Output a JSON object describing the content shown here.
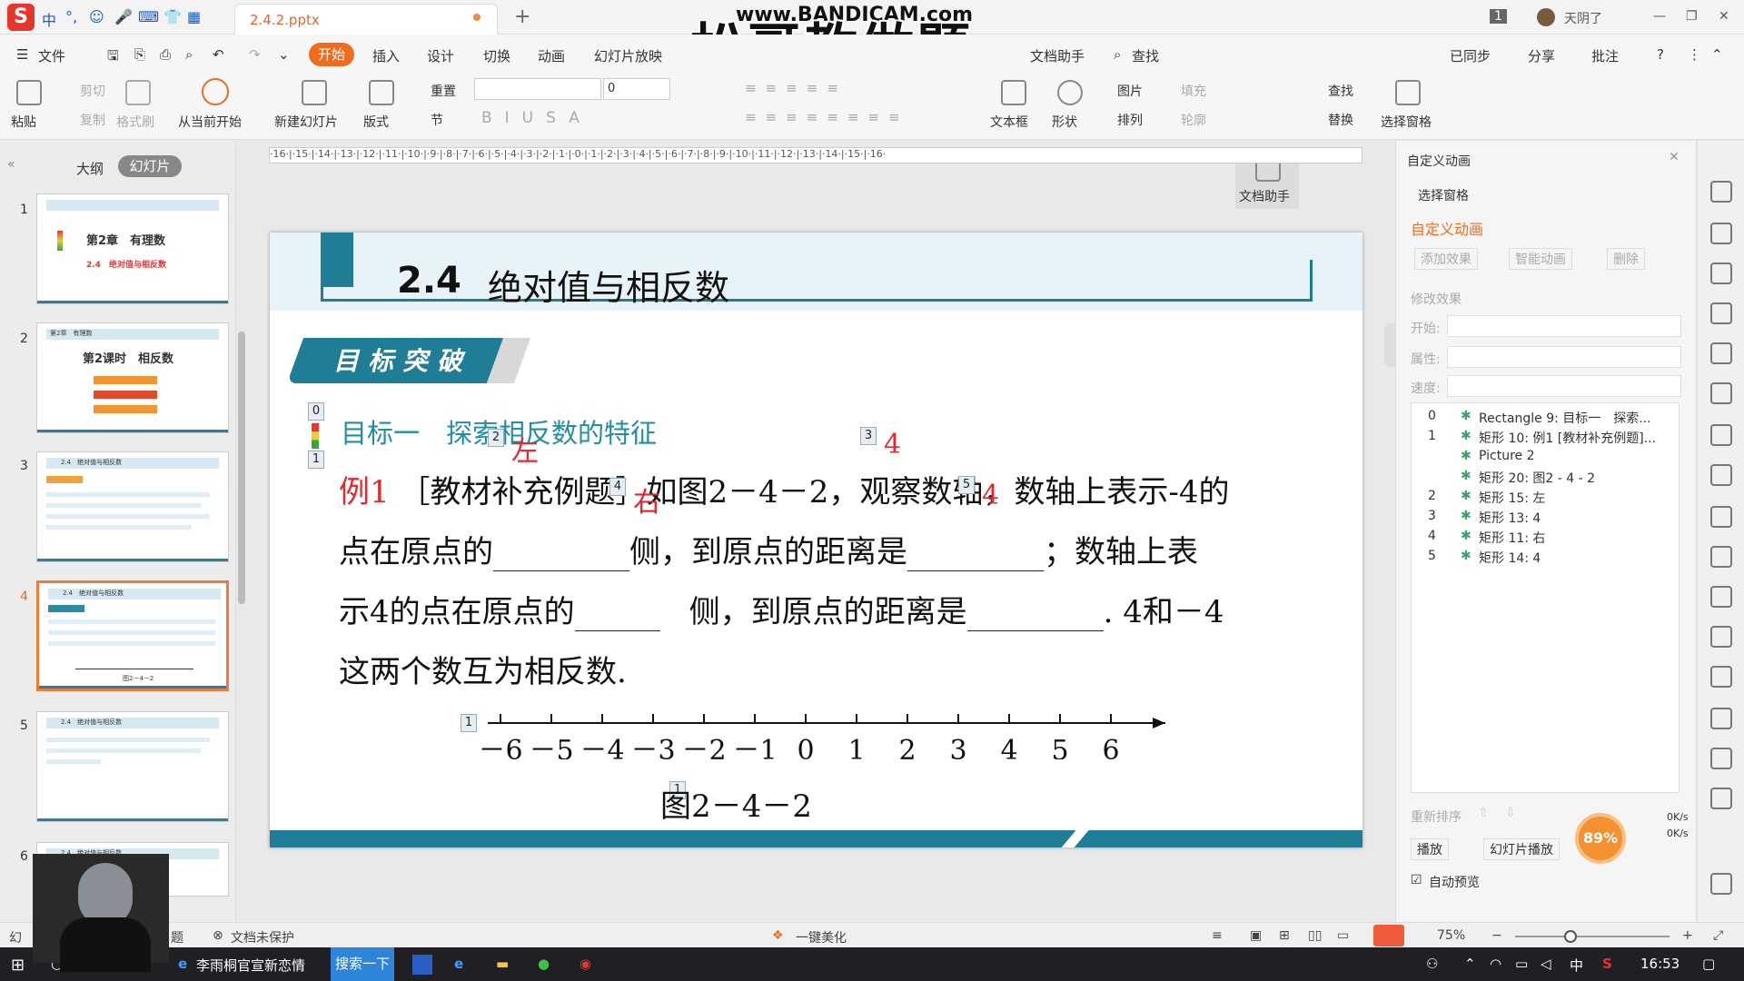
{
  "window": {
    "file_title": "2.4.2.pptx",
    "weather": "天阴了",
    "overlay_url": "www.BANDICAM.com",
    "overlay_text": "松哥教做题",
    "badge": "1"
  },
  "ime": [
    "中",
    "°,",
    "☺",
    "🎤",
    "⌨",
    "👕",
    "▦"
  ],
  "menu": [
    "文件",
    "开始",
    "插入",
    "设计",
    "切换",
    "动画",
    "幻灯片放映",
    "文档助手",
    "查找"
  ],
  "menu_right": [
    "已同步",
    "分享",
    "批注"
  ],
  "ribbon": {
    "paste": "粘贴",
    "cut": "剪切",
    "copy": "复制",
    "format_painter": "格式刷",
    "from_current": "从当前开始",
    "new_slide": "新建幻灯片",
    "layout": "版式",
    "reset": "重置",
    "section": "节",
    "font_size": "0",
    "textbox": "文本框",
    "shape": "形状",
    "picture": "图片",
    "fill": "填充",
    "arrange": "排列",
    "outline": "轮廓",
    "doc_assistant": "文档助手",
    "find": "查找",
    "replace": "替换",
    "selection_pane": "选择窗格"
  },
  "left_panel": {
    "tab_outline": "大纲",
    "tab_slides": "幻灯片",
    "numbers": [
      "1",
      "2",
      "3",
      "4",
      "5",
      "6"
    ]
  },
  "thumbs": {
    "t1_title": "第2章　有理数",
    "t1_sub": "2.4　绝对值与相反数",
    "t2_chapter": "第2章　有理数",
    "t2_title": "第2课时　相反数",
    "t3_head": "2.4　绝对值与相反数",
    "t4_head": "2.4　绝对值与相反数",
    "t5_head": "2.4　绝对值与相反数",
    "t6_head": "2.4　绝对值与相反数",
    "t4_caption": "图2－4－2"
  },
  "ruler": "·16·|·15·|·14·|·13·|·12·|·11·|·10·|·9·|·8·|·7·|·6·|·5·|·4·|·3·|·2·|·1·|·0·|·1·|·2·|·3·|·4·|·5·|·6·|·7·|·8·|·9·|·10·|·11·|·12·|·13·|·14·|·15·|·16·",
  "slide": {
    "title_num": "2.4",
    "title": "绝对值与相反数",
    "banner": "目标突破",
    "goal": "目标一　探索相反数的特征",
    "tags": [
      "0",
      "1",
      "2",
      "3",
      "4",
      "5",
      "1",
      "1"
    ],
    "example_label": "例1",
    "line1": "［教材补充例题］如图2－4－2，观察数轴，数轴上表示-4的",
    "line2a": "点在原点的",
    "line2b": "侧，到原点的距离是",
    "line2c": "；数轴上表",
    "line3a": "示4的点在原点的",
    "line3b": "侧，到原点的距离是",
    ".": "",
    "line3c": ". 4和－4",
    "line4": "这两个数互为相反数.",
    "answers": [
      "左",
      "4",
      "右",
      "4"
    ],
    "numline_labels": [
      "－6",
      "－5",
      "－4",
      "－3",
      "－2",
      "－1",
      "0",
      "1",
      "2",
      "3",
      "4",
      "5",
      "6"
    ],
    "fig_caption": "图2－4－2"
  },
  "right_pane": {
    "title": "自定义动画",
    "selection": "选择窗格",
    "custom_anim": "自定义动画",
    "add_effect": "添加效果",
    "smart_anim": "智能动画",
    "delete": "删除",
    "modify": "修改效果",
    "start": "开始:",
    "property": "属性:",
    "speed": "速度:",
    "reorder": "重新排序",
    "play": "播放",
    "slideshow": "幻灯片播放",
    "auto_preview": "自动预览",
    "speed_pct": "89%",
    "net_up": "0K/s",
    "net_down": "0K/s"
  },
  "anim_items": [
    {
      "num": "0",
      "text": "Rectangle 9: 目标一　探索..."
    },
    {
      "num": "1",
      "text": "矩形 10: 例1 [教材补充例题]..."
    },
    {
      "num": "",
      "text": "Picture 2"
    },
    {
      "num": "",
      "text": "矩形 20: 图2 - 4 - 2"
    },
    {
      "num": "2",
      "text": "矩形 15: 左"
    },
    {
      "num": "3",
      "text": "矩形 13: 4"
    },
    {
      "num": "4",
      "text": "矩形 11: 右"
    },
    {
      "num": "5",
      "text": "矩形 14: 4"
    }
  ],
  "status": {
    "left": "幻",
    "theme": "题",
    "protect": "文档未保护",
    "beautify": "一键美化",
    "zoom": "75%"
  },
  "taskbar": {
    "app1": "李雨桐官宣新恋情",
    "search": "搜索一下",
    "time": "16:53",
    "ime": "中"
  },
  "colors": {
    "accent": "#ef6c1e",
    "teal": "#1f7e95",
    "red": "#e8262b"
  }
}
